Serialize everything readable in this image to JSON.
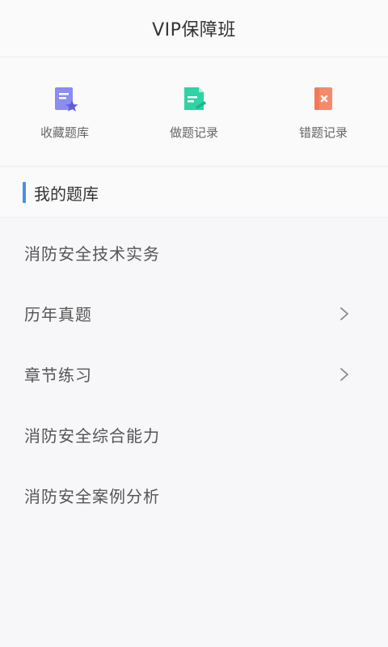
{
  "header": {
    "title": "VIP保障班"
  },
  "shortcuts": [
    {
      "label": "收藏题库",
      "icon": "favorite-bank-icon",
      "color": "#8a8cf0",
      "star_color": "#6c6ee6"
    },
    {
      "label": "做题记录",
      "icon": "practice-record-icon",
      "color": "#2fd3a4"
    },
    {
      "label": "错题记录",
      "icon": "wrong-record-icon",
      "color": "#f5896b"
    }
  ],
  "section": {
    "title": "我的题库",
    "accent": "#4a90e2"
  },
  "items": [
    {
      "label": "消防安全技术实务",
      "has_arrow": false
    },
    {
      "label": "历年真题",
      "has_arrow": true
    },
    {
      "label": "章节练习",
      "has_arrow": true
    },
    {
      "label": "消防安全综合能力",
      "has_arrow": false
    },
    {
      "label": "消防安全案例分析",
      "has_arrow": false
    }
  ]
}
